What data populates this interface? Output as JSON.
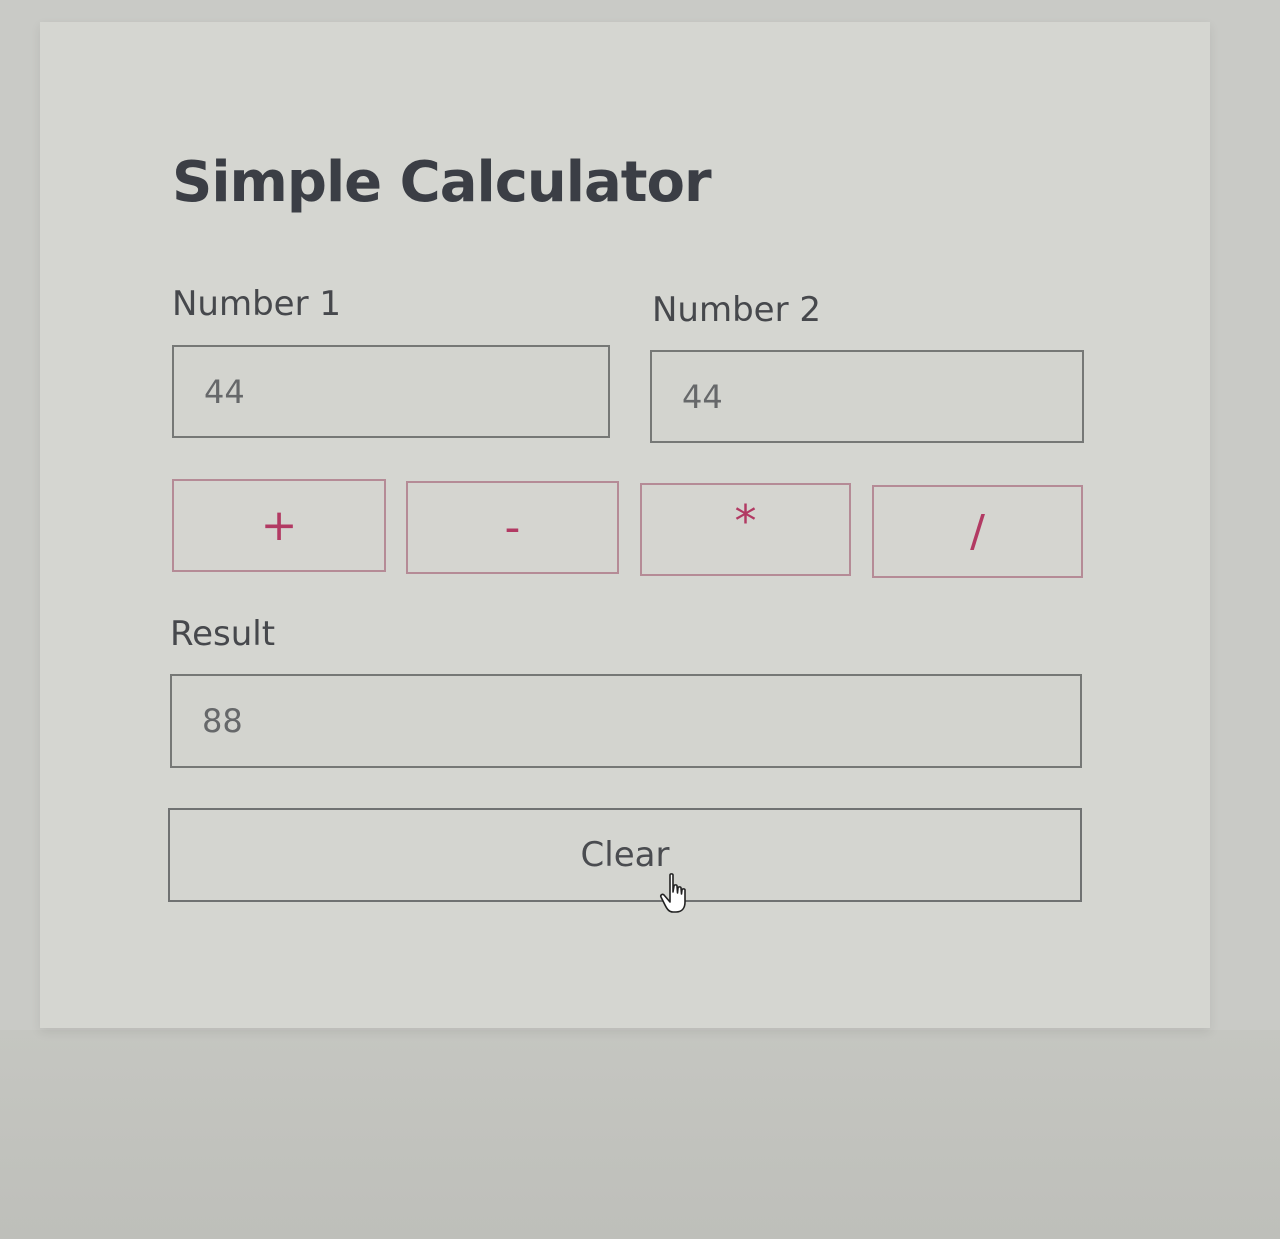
{
  "app": {
    "title": "Simple Calculator"
  },
  "inputs": {
    "number1": {
      "label": "Number 1",
      "value": "44"
    },
    "number2": {
      "label": "Number 2",
      "value": "44"
    }
  },
  "operations": [
    {
      "symbol": "+",
      "icon": "plus-icon"
    },
    {
      "symbol": "-",
      "icon": "minus-icon"
    },
    {
      "symbol": "*",
      "icon": "multiply-icon"
    },
    {
      "symbol": "/",
      "icon": "divide-icon"
    }
  ],
  "result": {
    "label": "Result",
    "value": "88"
  },
  "actions": {
    "clear_label": "Clear"
  },
  "colors": {
    "accent": "#b23a63",
    "operation_border": "#b58b96",
    "field_border": "#767876",
    "title": "#3b3e45"
  },
  "cursor": {
    "icon": "hand-pointer-icon"
  }
}
